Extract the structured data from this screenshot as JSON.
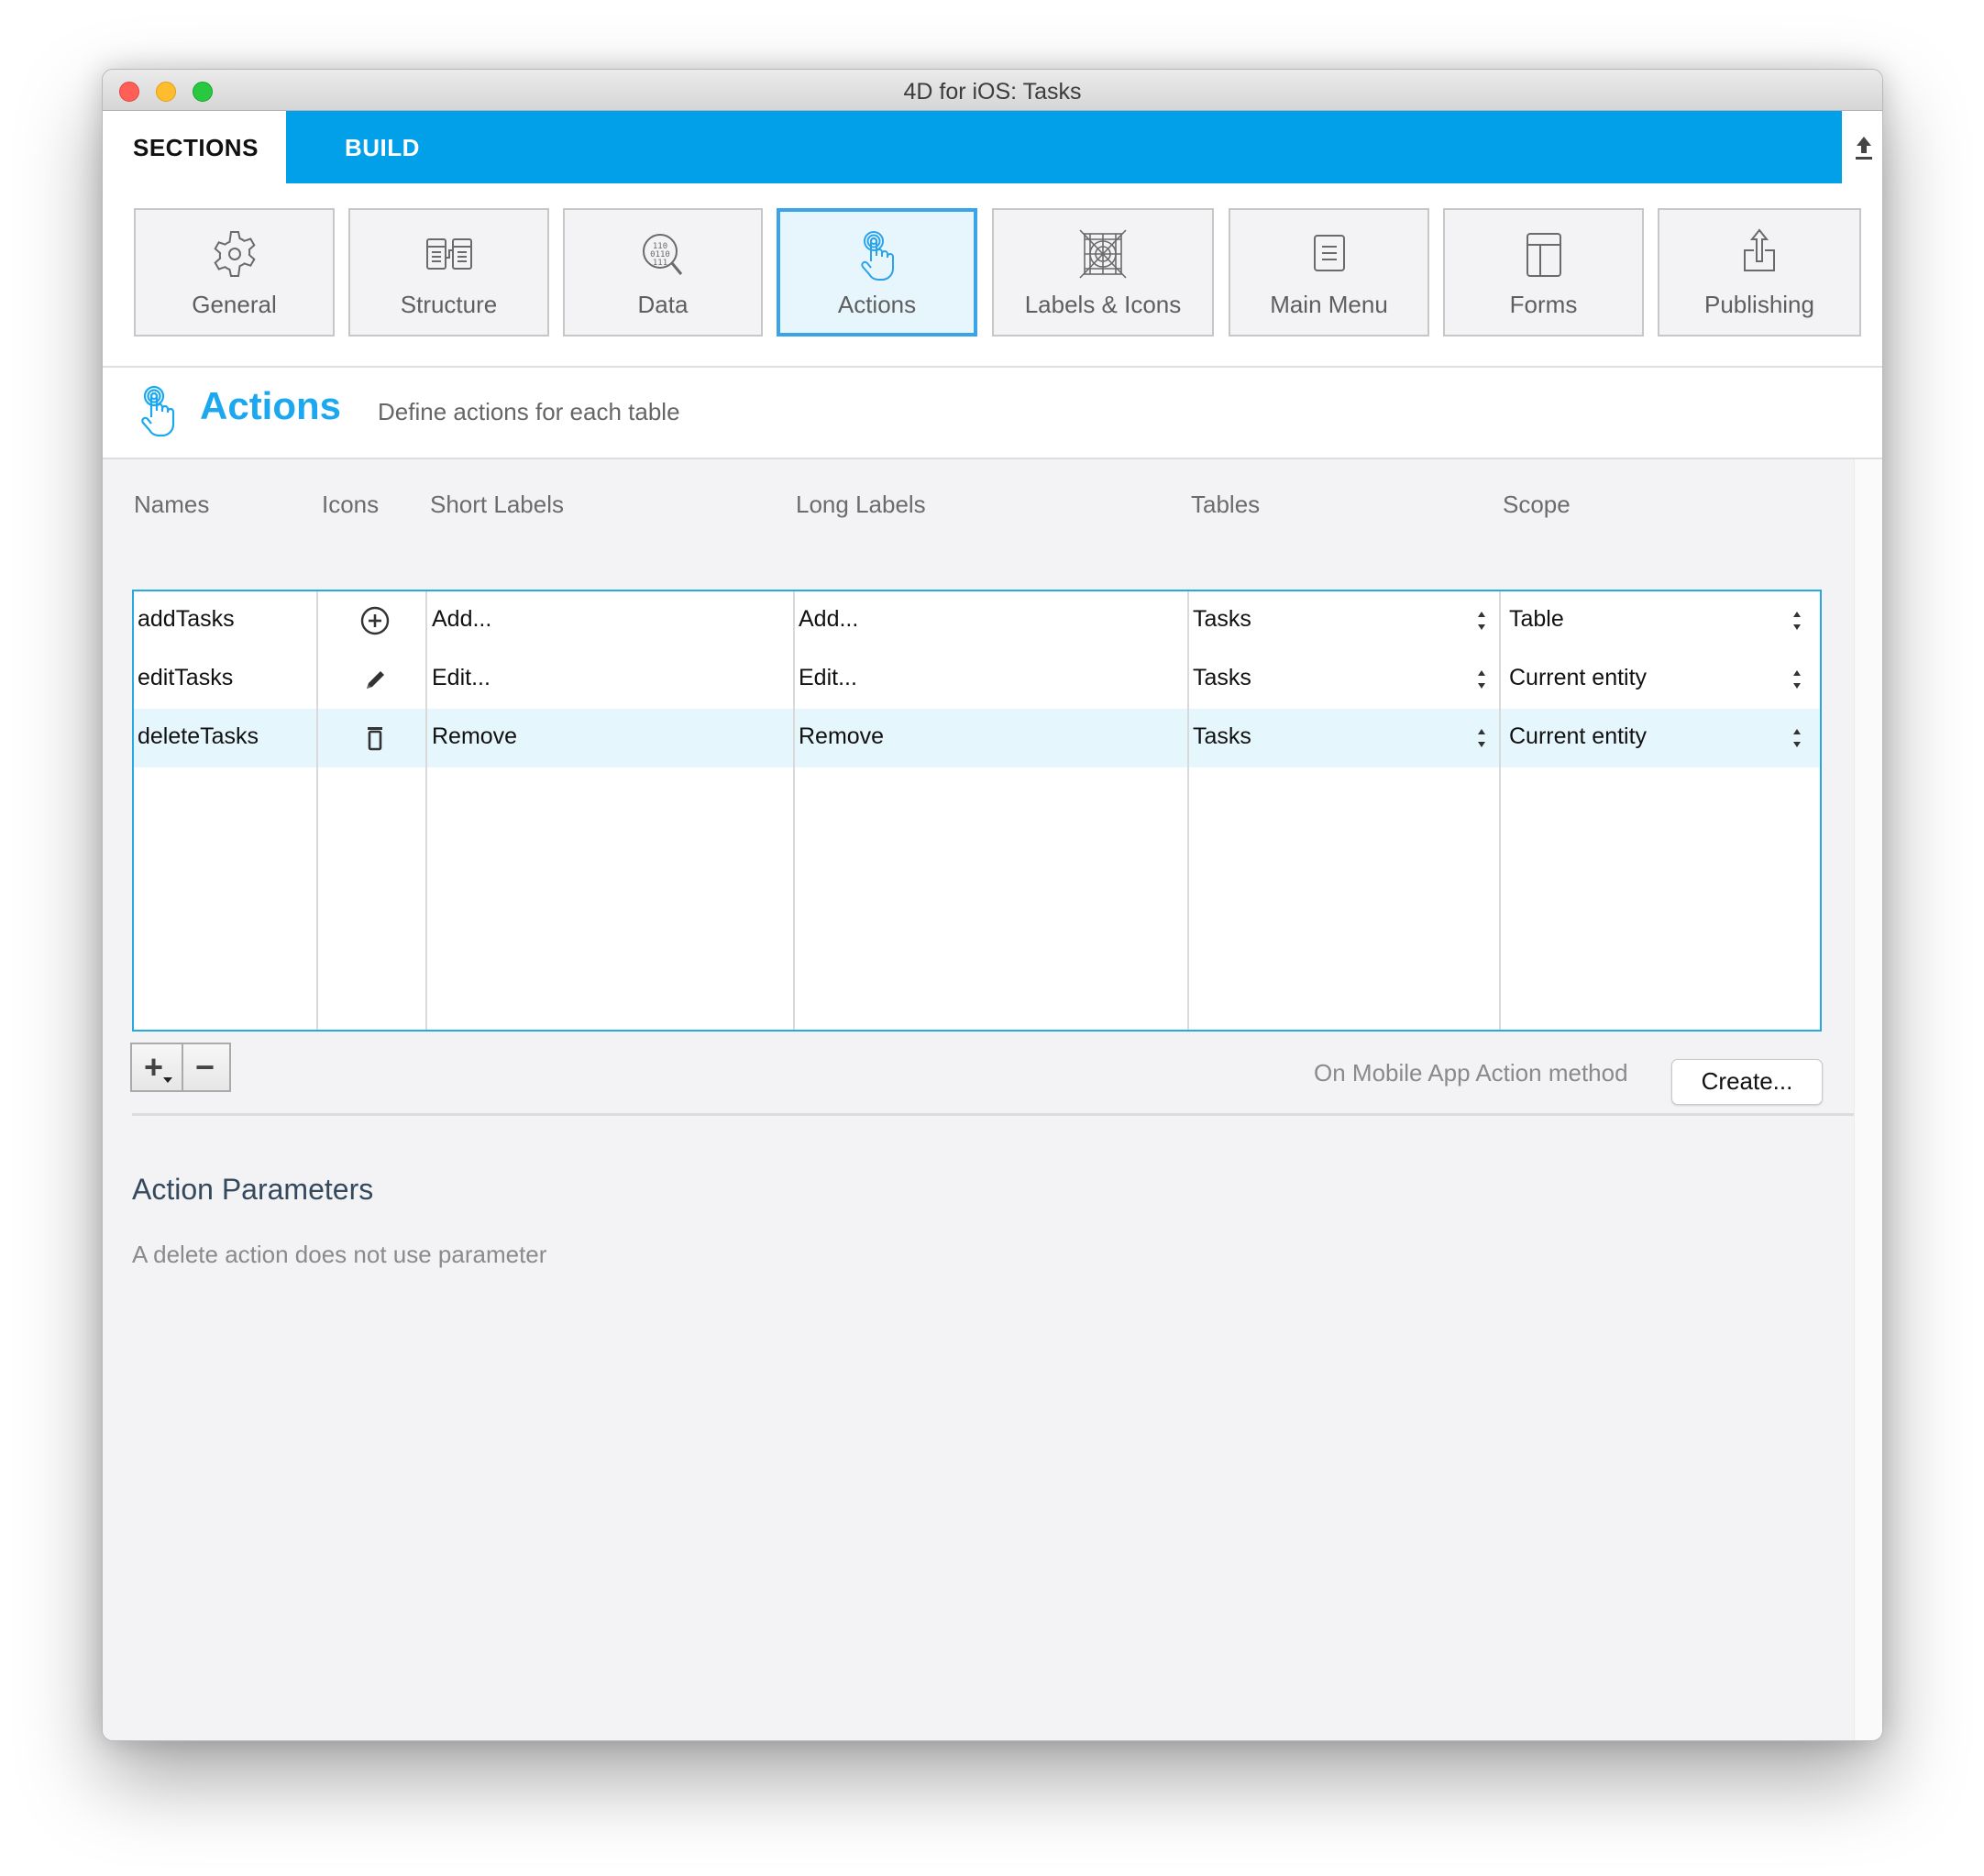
{
  "window": {
    "title": "4D for iOS: Tasks"
  },
  "tabs": [
    {
      "label": "SECTIONS",
      "active": true
    },
    {
      "label": "BUILD",
      "active": false
    }
  ],
  "toolbar": {
    "upload_icon": "upload-icon"
  },
  "sections": [
    {
      "label": "General",
      "icon": "gear-icon",
      "selected": false
    },
    {
      "label": "Structure",
      "icon": "structure-icon",
      "selected": false
    },
    {
      "label": "Data",
      "icon": "data-search-icon",
      "selected": false
    },
    {
      "label": "Actions",
      "icon": "tap-hand-icon",
      "selected": true
    },
    {
      "label": "Labels & Icons",
      "icon": "labels-icons-icon",
      "selected": false
    },
    {
      "label": "Main Menu",
      "icon": "menu-icon",
      "selected": false
    },
    {
      "label": "Forms",
      "icon": "forms-icon",
      "selected": false
    },
    {
      "label": "Publishing",
      "icon": "publish-icon",
      "selected": false
    }
  ],
  "header": {
    "title": "Actions",
    "description": "Define actions for each table",
    "accent_color": "#1ca8ef"
  },
  "table": {
    "columns": [
      "Names",
      "Icons",
      "Short Labels",
      "Long Labels",
      "Tables",
      "Scope"
    ],
    "rows": [
      {
        "name": "addTasks",
        "icon": "add-circle-icon",
        "short_label": "Add...",
        "long_label": "Add...",
        "table": "Tasks",
        "scope": "Table",
        "selected": false
      },
      {
        "name": "editTasks",
        "icon": "pencil-icon",
        "short_label": "Edit...",
        "long_label": "Edit...",
        "table": "Tasks",
        "scope": "Current entity",
        "selected": false
      },
      {
        "name": "deleteTasks",
        "icon": "trash-icon",
        "short_label": "Remove",
        "long_label": "Remove",
        "table": "Tasks",
        "scope": "Current entity",
        "selected": true
      }
    ]
  },
  "controls": {
    "add_symbol": "+",
    "remove_symbol": "−",
    "method_label": "On Mobile App Action method",
    "create_button": "Create..."
  },
  "parameters": {
    "title": "Action Parameters",
    "description": "A delete action does not use parameter"
  }
}
